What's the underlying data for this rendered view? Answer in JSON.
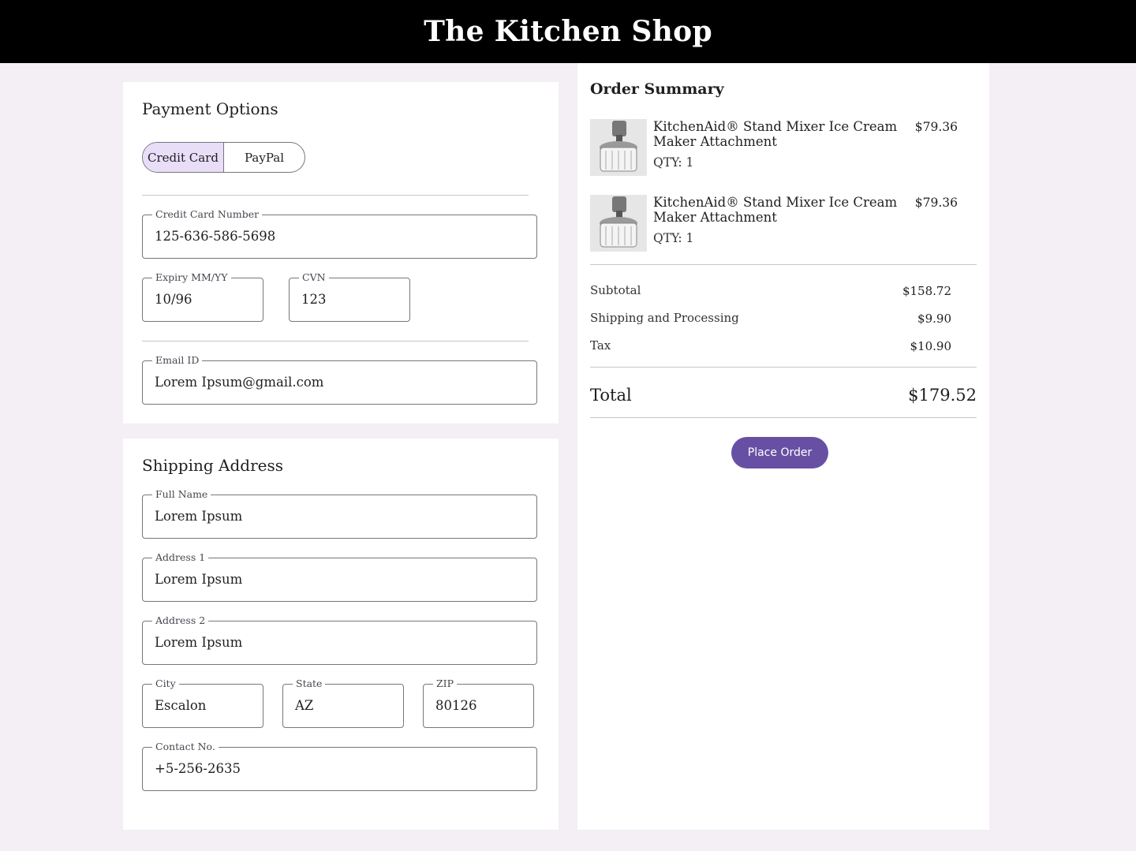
{
  "header": {
    "title": "The Kitchen Shop"
  },
  "payment": {
    "title": "Payment Options",
    "methods": [
      "Credit Card",
      "PayPal"
    ],
    "selected": "Credit Card",
    "card_number": {
      "label": "Credit Card Number",
      "value": "125-636-586-5698"
    },
    "expiry": {
      "label": "Expiry MM/YY",
      "value": "10/96"
    },
    "cvn": {
      "label": "CVN",
      "value": "123"
    },
    "email": {
      "label": "Email ID",
      "value": "Lorem Ipsum@gmail.com"
    }
  },
  "shipping": {
    "title": "Shipping Address",
    "full_name": {
      "label": "Full Name",
      "value": "Lorem Ipsum"
    },
    "address1": {
      "label": "Address 1",
      "value": "Lorem Ipsum"
    },
    "address2": {
      "label": "Address 2",
      "value": "Lorem Ipsum"
    },
    "city": {
      "label": "City",
      "value": "Escalon"
    },
    "state": {
      "label": "State",
      "value": "AZ"
    },
    "zip": {
      "label": "ZIP",
      "value": "80126"
    },
    "contact": {
      "label": "Contact No.",
      "value": "+5-256-2635"
    }
  },
  "summary": {
    "title": "Order Summary",
    "items": [
      {
        "name": "KitchenAid® Stand Mixer Ice Cream Maker Attachment",
        "qty": "QTY: 1",
        "price": "$79.36",
        "image_icon": "ice-cream-maker-photo"
      },
      {
        "name": "KitchenAid® Stand Mixer Ice Cream Maker Attachment",
        "qty": "QTY: 1",
        "price": "$79.36",
        "image_icon": "ice-cream-maker-photo"
      }
    ],
    "subtotal": {
      "label": "Subtotal",
      "value": "$158.72"
    },
    "shipping": {
      "label": "Shipping and Processing",
      "value": "$9.90"
    },
    "tax": {
      "label": "Tax",
      "value": "$10.90"
    },
    "total": {
      "label": "Total",
      "value": "$179.52"
    },
    "place_order": "Place Order"
  },
  "colors": {
    "accent": "#6750a4",
    "selected_bg": "#e8def8",
    "page_bg": "#f4eef5"
  }
}
